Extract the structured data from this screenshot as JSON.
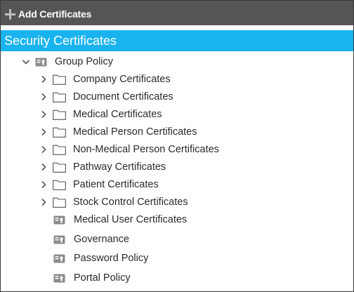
{
  "toolbar": {
    "add_label": "Add Certificates"
  },
  "header": {
    "title": "Security Certificates"
  },
  "tree": {
    "root": {
      "label": "Group Policy",
      "icon": "certificate-card-icon",
      "expanded": true
    },
    "folders": [
      {
        "label": "Company Certificates"
      },
      {
        "label": "Document Certificates"
      },
      {
        "label": "Medical Certificates"
      },
      {
        "label": "Medical Person Certificates"
      },
      {
        "label": "Non-Medical Person Certificates"
      },
      {
        "label": "Pathway Certificates"
      },
      {
        "label": "Patient Certificates"
      },
      {
        "label": "Stock Control Certificates"
      }
    ],
    "items": [
      {
        "label": "Medical User Certificates"
      },
      {
        "label": "Governance"
      },
      {
        "label": "Password Policy"
      },
      {
        "label": "Portal Policy"
      }
    ]
  },
  "colors": {
    "toolbar_bg": "#555555",
    "header_bg": "#19b3ef",
    "icon_gray": "#8a8a8a"
  }
}
